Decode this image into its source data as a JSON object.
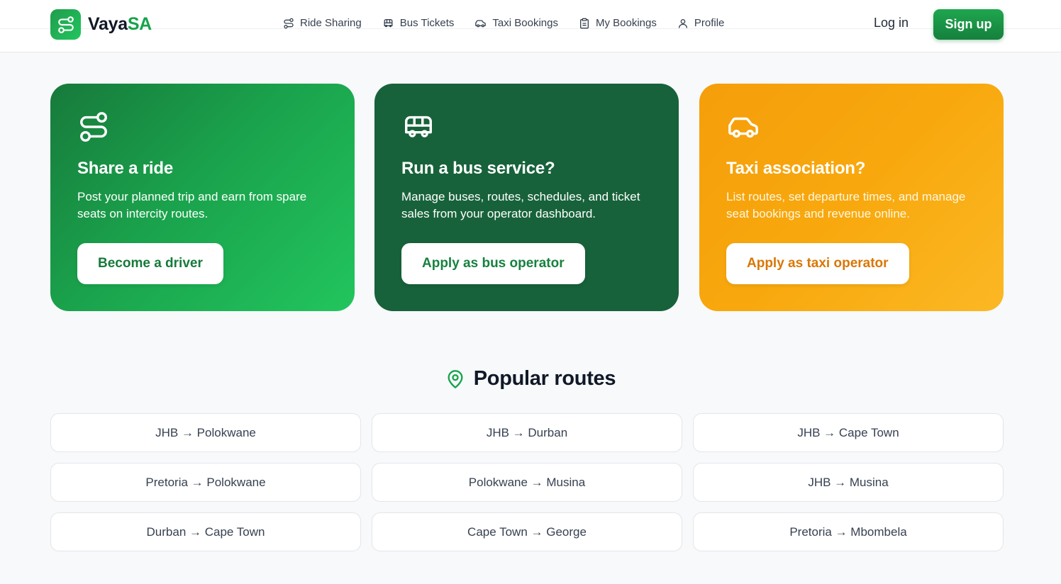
{
  "brand": {
    "name_main": "Vaya",
    "name_accent": "SA"
  },
  "nav": {
    "items": [
      {
        "label": "Ride Sharing",
        "icon": "route-icon"
      },
      {
        "label": "Bus Tickets",
        "icon": "bus-icon"
      },
      {
        "label": "Taxi Bookings",
        "icon": "car-icon"
      },
      {
        "label": "My Bookings",
        "icon": "clipboard-icon"
      },
      {
        "label": "Profile",
        "icon": "user-icon"
      }
    ],
    "login_label": "Log in",
    "signup_label": "Sign up"
  },
  "cards": [
    {
      "title": "Share a ride",
      "description": "Post your planned trip and earn from spare seats on intercity routes.",
      "button": "Become a driver",
      "icon": "route-icon",
      "color": "#1aa24c"
    },
    {
      "title": "Run a bus service?",
      "description": "Manage buses, routes, schedules, and ticket sales from your operator dashboard.",
      "button": "Apply as bus operator",
      "icon": "bus-icon",
      "color": "#17623a"
    },
    {
      "title": "Taxi association?",
      "description": "List routes, set departure times, and manage seat bookings and revenue online.",
      "button": "Apply as taxi operator",
      "icon": "car-icon",
      "color": "#f8a80d"
    }
  ],
  "popular": {
    "title": "Popular routes",
    "icon": "map-pin-icon",
    "routes": [
      "JHB → Polokwane",
      "JHB → Durban",
      "JHB → Cape Town",
      "Pretoria → Polokwane",
      "Polokwane → Musina",
      "JHB → Musina",
      "Durban → Cape Town",
      "Cape Town → George",
      "Pretoria → Mbombela"
    ]
  },
  "colors": {
    "accent": "#16a34a",
    "dark_green": "#17623a",
    "amber": "#f59e0b"
  }
}
